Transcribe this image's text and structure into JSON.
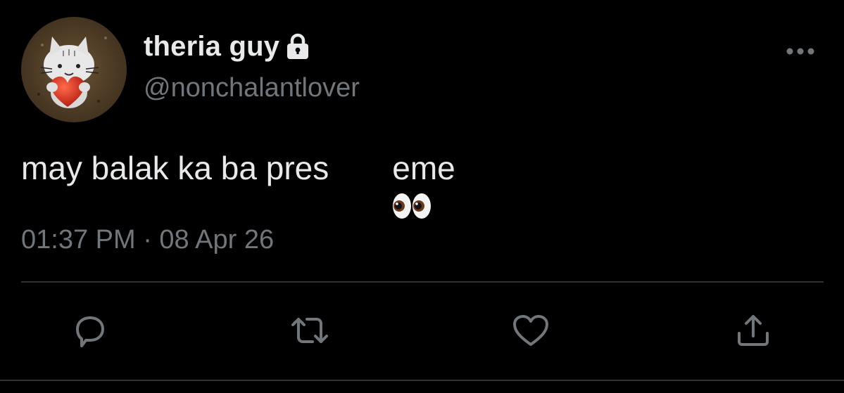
{
  "author": {
    "display_name": "theria guy",
    "handle": "@nonchalantlover",
    "avatar_icon": "cat-holding-heart-avatar",
    "protected_icon": "lock-icon"
  },
  "tweet": {
    "text_before": "may balak ka ba pres",
    "emoji": "eyes-emoji",
    "text_after": "eme",
    "timestamp": "01:37 PM · 08 Apr 26"
  },
  "actions": {
    "reply_icon": "reply-icon",
    "retweet_icon": "retweet-icon",
    "like_icon": "heart-icon",
    "share_icon": "share-icon",
    "more_icon": "more-icon"
  },
  "colors": {
    "background": "#000000",
    "primary_text": "#e7e9ea",
    "secondary_text": "#71767b",
    "icon": "#71767b",
    "divider": "#2f3336"
  }
}
